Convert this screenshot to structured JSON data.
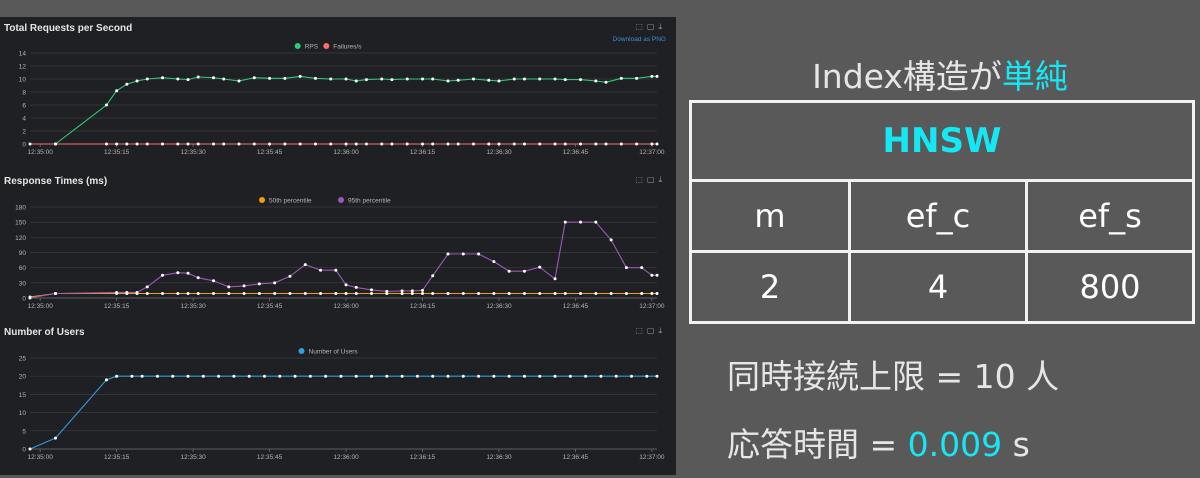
{
  "chart_data": [
    {
      "type": "line",
      "title": "Total Requests per Second",
      "download_label": "Download as PNG",
      "x": [
        "12:34:58",
        "12:35:03",
        "12:35:08",
        "12:35:13",
        "12:35:15",
        "12:35:17",
        "12:35:19",
        "12:35:21",
        "12:35:24",
        "12:35:27",
        "12:35:29",
        "12:35:31",
        "12:35:34",
        "12:35:36",
        "12:35:39",
        "12:35:42",
        "12:35:45",
        "12:35:48",
        "12:35:51",
        "12:35:54",
        "12:35:57",
        "12:36:00",
        "12:36:02",
        "12:36:04",
        "12:36:07",
        "12:36:09",
        "12:36:12",
        "12:36:15",
        "12:36:17",
        "12:36:20",
        "12:36:22",
        "12:36:25",
        "12:36:28",
        "12:36:30",
        "12:36:33",
        "12:36:35",
        "12:36:38",
        "12:36:41",
        "12:36:43",
        "12:36:46",
        "12:36:49",
        "12:36:51",
        "12:36:54",
        "12:36:57",
        "12:37:00",
        "12:37:01"
      ],
      "x_ticks": [
        "12:35:00",
        "12:35:15",
        "12:35:30",
        "12:35:45",
        "12:36:00",
        "12:36:15",
        "12:36:30",
        "12:36:45",
        "12:37:00"
      ],
      "ylim": [
        0,
        14
      ],
      "y_ticks": [
        0,
        2,
        4,
        6,
        8,
        10,
        12,
        14
      ],
      "series": [
        {
          "name": "RPS",
          "color": "#2ecc71",
          "values": [
            null,
            0,
            null,
            6,
            8.2,
            9.2,
            9.7,
            10,
            10.2,
            10,
            9.9,
            10.3,
            10.2,
            10,
            9.7,
            10.2,
            10.1,
            10.1,
            10.4,
            10.1,
            10,
            10,
            9.7,
            9.9,
            10,
            9.9,
            10,
            10,
            10,
            9.7,
            9.8,
            10,
            9.8,
            9.7,
            10,
            10,
            10,
            10,
            9.9,
            9.9,
            9.7,
            9.5,
            10.1,
            10.1,
            10.4,
            10.4
          ]
        },
        {
          "name": "Failures/s",
          "color": "#ff6b6b",
          "values": [
            0,
            0,
            null,
            0,
            0,
            0,
            0,
            0,
            0,
            0,
            0,
            0,
            0,
            0,
            0,
            0,
            0,
            0,
            0,
            0,
            0,
            0,
            0,
            0,
            0,
            0,
            0,
            0,
            0,
            0,
            0,
            0,
            0,
            0,
            0,
            0,
            0,
            0,
            0,
            0,
            0,
            0,
            0,
            0,
            0,
            0
          ]
        }
      ]
    },
    {
      "type": "line",
      "title": "Response Times (ms)",
      "x": [
        "12:34:58",
        "12:35:03",
        "12:35:15",
        "12:35:17",
        "12:35:19",
        "12:35:21",
        "12:35:24",
        "12:35:27",
        "12:35:29",
        "12:35:31",
        "12:35:34",
        "12:35:37",
        "12:35:40",
        "12:35:43",
        "12:35:46",
        "12:35:49",
        "12:35:52",
        "12:35:55",
        "12:35:58",
        "12:36:00",
        "12:36:02",
        "12:36:05",
        "12:36:08",
        "12:36:11",
        "12:36:13",
        "12:36:15",
        "12:36:17",
        "12:36:20",
        "12:36:23",
        "12:36:26",
        "12:36:29",
        "12:36:32",
        "12:36:35",
        "12:36:38",
        "12:36:41",
        "12:36:43",
        "12:36:46",
        "12:36:49",
        "12:36:52",
        "12:36:55",
        "12:36:58",
        "12:37:00",
        "12:37:01"
      ],
      "x_ticks": [
        "12:35:00",
        "12:35:15",
        "12:35:30",
        "12:35:45",
        "12:36:00",
        "12:36:15",
        "12:36:30",
        "12:36:45",
        "12:37:00"
      ],
      "ylim": [
        0,
        180
      ],
      "y_ticks": [
        0,
        30,
        60,
        90,
        120,
        150,
        180
      ],
      "series": [
        {
          "name": "50th percentile",
          "color": "#f39c12",
          "values": [
            2,
            9,
            9,
            9,
            9,
            9,
            9,
            9,
            9,
            9,
            9,
            9,
            9,
            9,
            9,
            9,
            9,
            9,
            9,
            9,
            9,
            9,
            9,
            9,
            9,
            9,
            9,
            9,
            9,
            9,
            9,
            9,
            9,
            9,
            9,
            9,
            9,
            9,
            9,
            9,
            9,
            9,
            9
          ]
        },
        {
          "name": "95th percentile",
          "color": "#9b59b6",
          "values": [
            0,
            9,
            11,
            11,
            11,
            22,
            45,
            50,
            49,
            40,
            34,
            22,
            24,
            28,
            30,
            43,
            66,
            55,
            55,
            26,
            21,
            16,
            13,
            14,
            14,
            15,
            44,
            87,
            87,
            87,
            72,
            53,
            53,
            61,
            38,
            150,
            150,
            150,
            115,
            60,
            60,
            45,
            45
          ]
        }
      ]
    },
    {
      "type": "line",
      "title": "Number of Users",
      "x": [
        "12:34:58",
        "12:35:03",
        "12:35:13",
        "12:35:15",
        "12:35:18",
        "12:35:20",
        "12:35:23",
        "12:35:26",
        "12:35:29",
        "12:35:32",
        "12:35:35",
        "12:35:38",
        "12:35:41",
        "12:35:44",
        "12:35:47",
        "12:35:50",
        "12:35:53",
        "12:35:56",
        "12:35:59",
        "12:36:02",
        "12:36:05",
        "12:36:08",
        "12:36:11",
        "12:36:14",
        "12:36:17",
        "12:36:20",
        "12:36:23",
        "12:36:26",
        "12:36:29",
        "12:36:32",
        "12:36:35",
        "12:36:38",
        "12:36:41",
        "12:36:44",
        "12:36:47",
        "12:36:50",
        "12:36:53",
        "12:36:56",
        "12:36:59",
        "12:37:01"
      ],
      "x_ticks": [
        "12:35:00",
        "12:35:15",
        "12:35:30",
        "12:35:45",
        "12:36:00",
        "12:36:15",
        "12:36:30",
        "12:36:45",
        "12:37:00"
      ],
      "ylim": [
        0,
        25
      ],
      "y_ticks": [
        0,
        5,
        10,
        15,
        20,
        25
      ],
      "series": [
        {
          "name": "Number of Users",
          "color": "#2f9de0",
          "values": [
            0,
            3,
            19,
            20,
            20,
            20,
            20,
            20,
            20,
            20,
            20,
            20,
            20,
            20,
            20,
            20,
            20,
            20,
            20,
            20,
            20,
            20,
            20,
            20,
            20,
            20,
            20,
            20,
            20,
            20,
            20,
            20,
            20,
            20,
            20,
            20,
            20,
            20,
            20,
            20
          ]
        }
      ]
    }
  ],
  "right": {
    "heading_prefix": "Index構造が",
    "heading_highlight": "単純",
    "table": {
      "title": "HNSW",
      "headers": [
        "m",
        "ef_c",
        "ef_s"
      ],
      "values": [
        "2",
        "4",
        "800"
      ]
    },
    "concurrency_line": "同時接続上限 = 10 人",
    "response_prefix": "応答時間 = ",
    "response_value": "0.009",
    "response_unit": " s"
  },
  "colors": {
    "accent_cyan": "#14e8f5",
    "slide_bg": "#595959",
    "dashboard_bg": "#1f2023"
  }
}
